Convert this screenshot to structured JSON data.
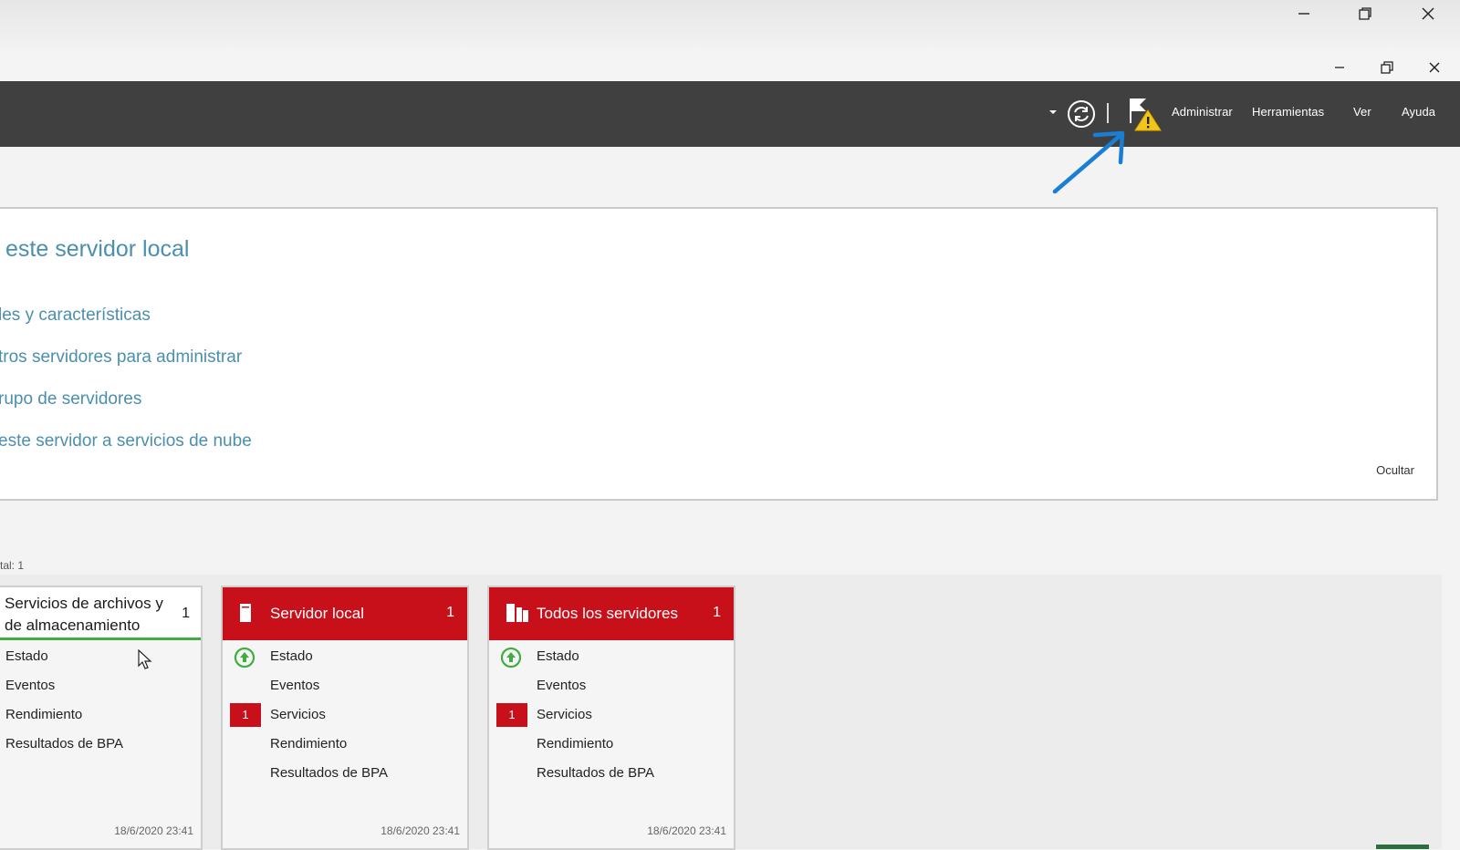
{
  "header": {
    "menu": [
      "Administrar",
      "Herramientas",
      "Ver",
      "Ayuda"
    ],
    "icons": [
      "dropdown-caret-icon",
      "refresh-icon",
      "notification-flag-warning-icon"
    ]
  },
  "welcome": {
    "title": "este servidor local",
    "links": [
      "les y características",
      "tros servidores para administrar",
      "rupo de servidores",
      "este servidor a servicios de nube"
    ],
    "hide_label": "Ocultar"
  },
  "total_label": "tal: 1",
  "tiles": [
    {
      "title": "Servicios de archivos y de almacenamiento",
      "count": "1",
      "rows": [
        "Estado",
        "Eventos",
        "Rendimiento",
        "Resultados de BPA"
      ],
      "date": "18/6/2020 23:41"
    },
    {
      "title": "Servidor local",
      "count": "1",
      "rows": [
        "Estado",
        "Eventos",
        "Servicios",
        "Rendimiento",
        "Resultados de BPA"
      ],
      "services_alert": "1",
      "date": "18/6/2020 23:41"
    },
    {
      "title": "Todos los servidores",
      "count": "1",
      "rows": [
        "Estado",
        "Eventos",
        "Servicios",
        "Rendimiento",
        "Resultados de BPA"
      ],
      "services_alert": "1",
      "date": "18/6/2020 23:41"
    }
  ],
  "colors": {
    "header_bg": "#404040",
    "tile_red": "#c8101a",
    "link_blue": "#4a8fb0",
    "annotation_arrow": "#1a7fd4",
    "status_green": "#3fae3f"
  }
}
